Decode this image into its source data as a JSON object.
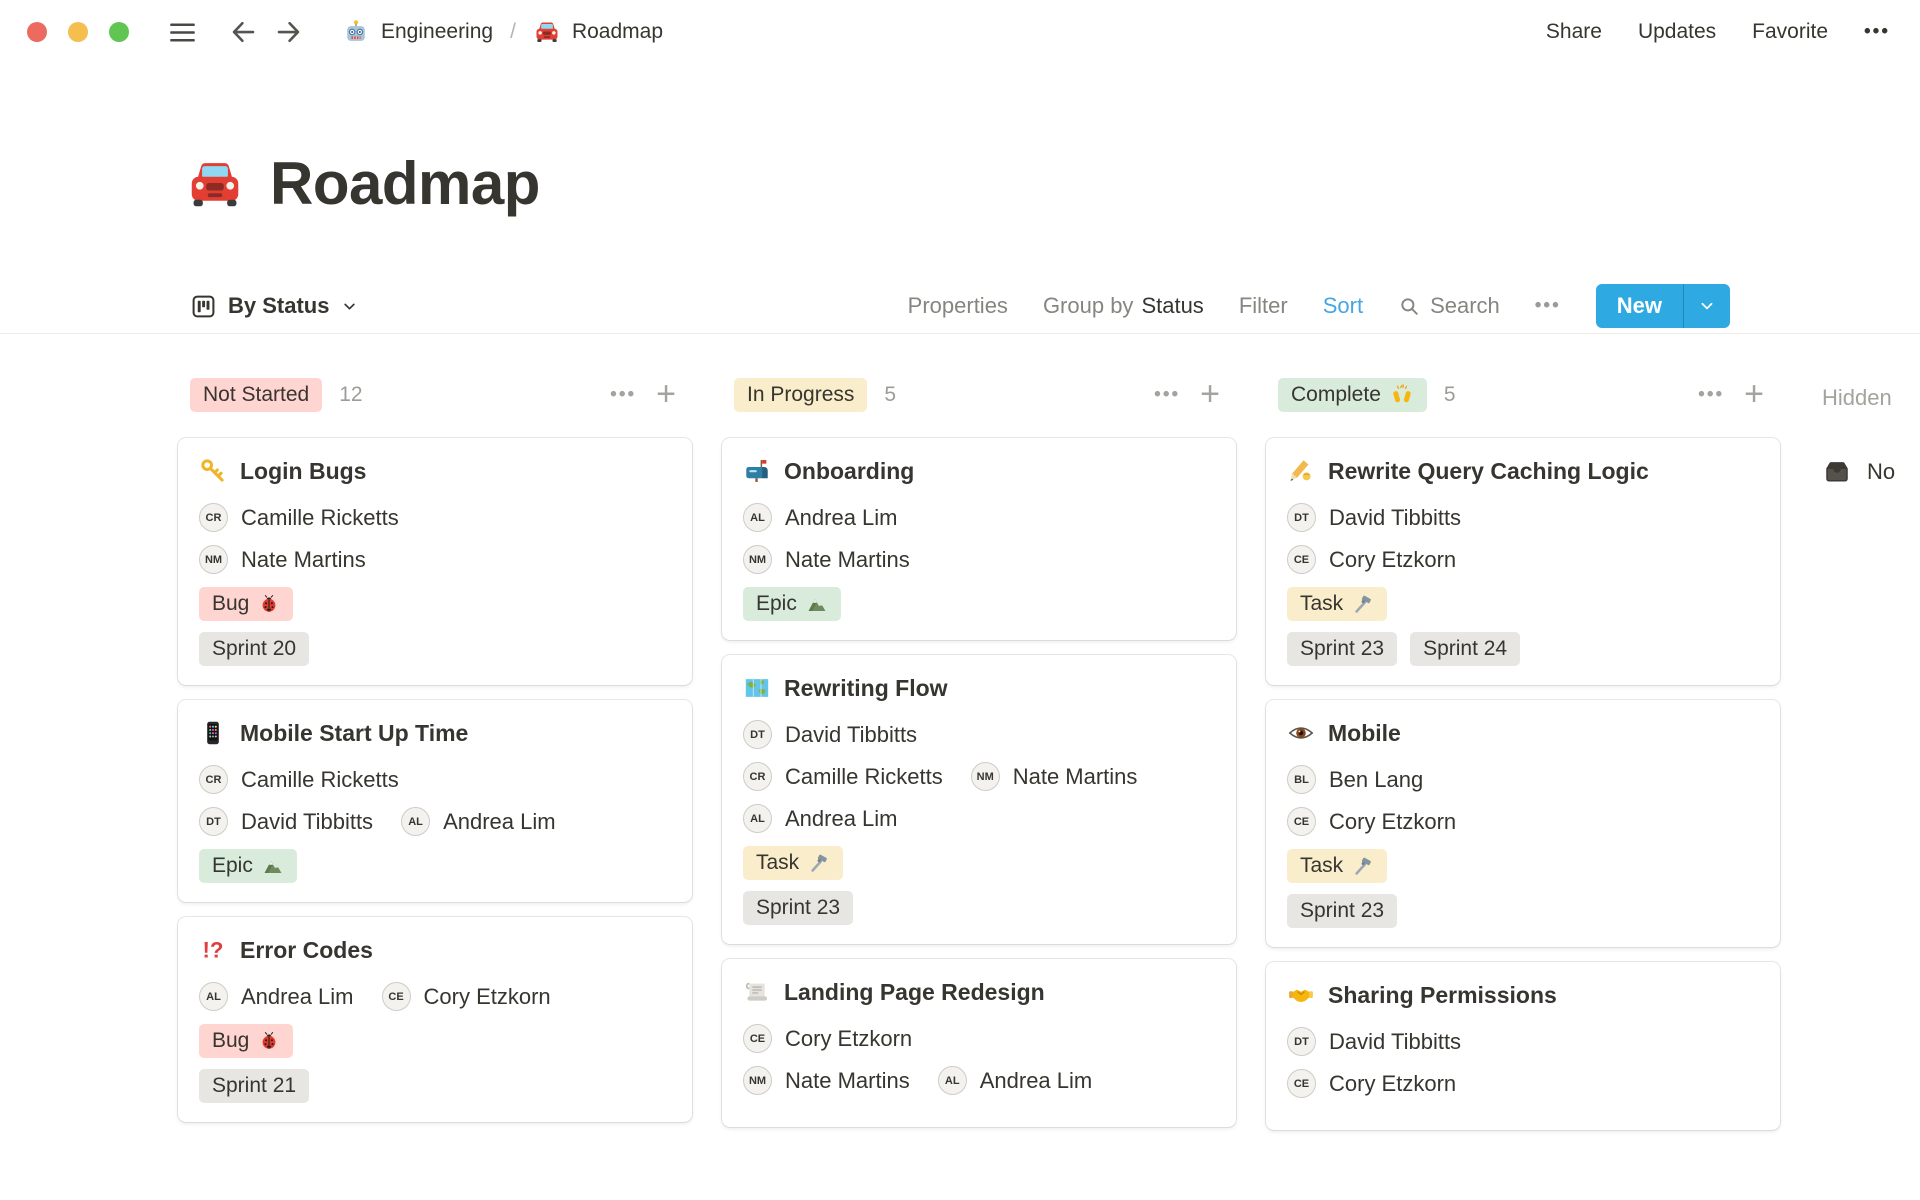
{
  "chrome": {
    "traffic_lights": [
      "#EC6A5E",
      "#F5BF4F",
      "#61C554"
    ],
    "breadcrumb": {
      "workspace_icon": "robot",
      "workspace": "Engineering",
      "separator": "/",
      "page_icon": "car",
      "page": "Roadmap"
    },
    "actions": {
      "share": "Share",
      "updates": "Updates",
      "favorite": "Favorite",
      "more": "•••"
    }
  },
  "page": {
    "icon": "car",
    "title": "Roadmap"
  },
  "toolbar": {
    "view_icon": "board",
    "view_label": "By Status",
    "properties": "Properties",
    "group_by": "Group by",
    "group_by_value": "Status",
    "filter": "Filter",
    "sort": "Sort",
    "sort_color": "#46A6E3",
    "search": "Search",
    "more": "•••",
    "new_label": "New",
    "accent_color": "#2EA9E1"
  },
  "board": {
    "columns": [
      {
        "name": "Not Started",
        "count": "12",
        "badge_bg": "#FFD5D1",
        "cards": [
          {
            "icon": "key",
            "title": "Login Bugs",
            "people_rows": [
              [
                "Camille Ricketts"
              ],
              [
                "Nate Martins"
              ]
            ],
            "tag_rows": [
              [
                {
                  "label": "Bug",
                  "icon": "ladybug",
                  "bg": "#FFD5D1"
                }
              ],
              [
                {
                  "label": "Sprint 20",
                  "bg": "#E7E6E3"
                }
              ]
            ]
          },
          {
            "icon": "smartphone",
            "title": "Mobile Start Up Time",
            "people_rows": [
              [
                "Camille Ricketts"
              ],
              [
                "David Tibbitts",
                "Andrea Lim"
              ]
            ],
            "tag_rows": [
              [
                {
                  "label": "Epic",
                  "icon": "mountain",
                  "bg": "#D9ECDC"
                }
              ]
            ]
          },
          {
            "icon": "interrobang",
            "title": "Error Codes",
            "people_rows": [
              [
                "Andrea Lim",
                "Cory Etzkorn"
              ]
            ],
            "tag_rows": [
              [
                {
                  "label": "Bug",
                  "icon": "ladybug",
                  "bg": "#FFD5D1"
                }
              ],
              [
                {
                  "label": "Sprint 21",
                  "bg": "#E7E6E3"
                }
              ]
            ]
          }
        ]
      },
      {
        "name": "In Progress",
        "count": "5",
        "badge_bg": "#FAEDCB",
        "cards": [
          {
            "icon": "mailbox",
            "title": "Onboarding",
            "people_rows": [
              [
                "Andrea Lim"
              ],
              [
                "Nate Martins"
              ]
            ],
            "tag_rows": [
              [
                {
                  "label": "Epic",
                  "icon": "mountain",
                  "bg": "#D9ECDC"
                }
              ]
            ]
          },
          {
            "icon": "worldmap",
            "title": "Rewriting Flow",
            "people_rows": [
              [
                "David Tibbitts"
              ],
              [
                "Camille Ricketts",
                "Nate Martins"
              ],
              [
                "Andrea Lim"
              ]
            ],
            "tag_rows": [
              [
                {
                  "label": "Task",
                  "icon": "hammer",
                  "bg": "#FAEDCB"
                }
              ],
              [
                {
                  "label": "Sprint 23",
                  "bg": "#E7E6E3"
                }
              ]
            ]
          },
          {
            "icon": "scroll",
            "title": "Landing Page Redesign",
            "people_rows": [
              [
                "Cory Etzkorn"
              ],
              [
                "Nate Martins",
                "Andrea Lim"
              ]
            ],
            "tag_rows": []
          }
        ]
      },
      {
        "name": "Complete",
        "badge_icon": "raised-hands",
        "count": "5",
        "badge_bg": "#D9ECDC",
        "cards": [
          {
            "icon": "writing-hand",
            "title": "Rewrite Query Caching Logic",
            "people_rows": [
              [
                "David Tibbitts"
              ],
              [
                "Cory Etzkorn"
              ]
            ],
            "tag_rows": [
              [
                {
                  "label": "Task",
                  "icon": "hammer",
                  "bg": "#FAEDCB"
                }
              ],
              [
                {
                  "label": "Sprint 23",
                  "bg": "#E7E6E3"
                },
                {
                  "label": "Sprint 24",
                  "bg": "#E7E6E3"
                }
              ]
            ]
          },
          {
            "icon": "eye",
            "title": "Mobile",
            "people_rows": [
              [
                "Ben Lang"
              ],
              [
                "Cory Etzkorn"
              ]
            ],
            "tag_rows": [
              [
                {
                  "label": "Task",
                  "icon": "hammer",
                  "bg": "#FAEDCB"
                }
              ],
              [
                {
                  "label": "Sprint 23",
                  "bg": "#E7E6E3"
                }
              ]
            ]
          },
          {
            "icon": "handshake",
            "title": "Sharing Permissions",
            "people_rows": [
              [
                "David Tibbitts"
              ],
              [
                "Cory Etzkorn"
              ]
            ],
            "tag_rows": []
          }
        ]
      }
    ],
    "hidden": {
      "label": "Hidden",
      "group_icon": "inbox",
      "group_label": "No"
    }
  }
}
